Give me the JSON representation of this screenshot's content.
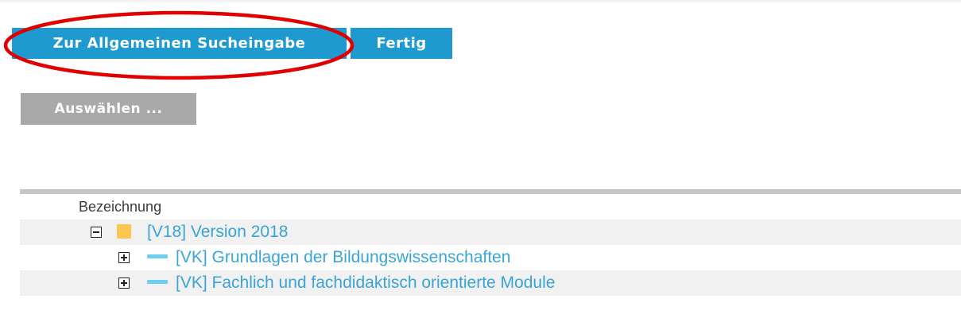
{
  "toolbar": {
    "search_label": "Zur Allgemeinen Sucheingabe",
    "done_label": "Fertig"
  },
  "select_label": "Auswählen ...",
  "annotation_color": "#e00000",
  "tree": {
    "header": "Bezeichnung",
    "rows": [
      {
        "label": "[V18] Version 2018",
        "icon": "folder-icon",
        "toggle": "minus"
      },
      {
        "label": "[VK] Grundlagen der Bildungswissenschaften",
        "icon": "bar-icon",
        "toggle": "plus"
      },
      {
        "label": "[VK] Fachlich und fachdidaktisch orientierte Module",
        "icon": "bar-icon",
        "toggle": "plus"
      }
    ]
  }
}
